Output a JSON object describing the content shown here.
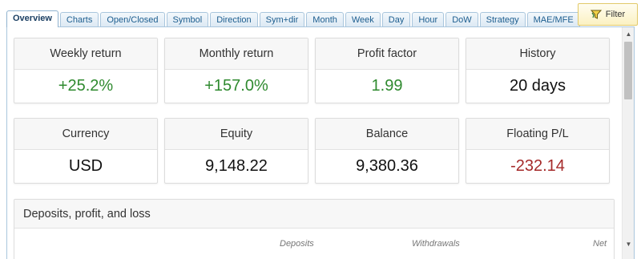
{
  "tabs": [
    {
      "label": "Overview",
      "active": true
    },
    {
      "label": "Charts"
    },
    {
      "label": "Open/Closed"
    },
    {
      "label": "Symbol"
    },
    {
      "label": "Direction"
    },
    {
      "label": "Sym+dir"
    },
    {
      "label": "Month"
    },
    {
      "label": "Week"
    },
    {
      "label": "Day"
    },
    {
      "label": "Hour"
    },
    {
      "label": "DoW"
    },
    {
      "label": "Strategy"
    },
    {
      "label": "MAE/MFE"
    }
  ],
  "filter": {
    "label": "Filter",
    "icon": "filter-funnel-icon"
  },
  "cards": [
    {
      "title": "Weekly return",
      "value": "+25.2%",
      "tone": "positive"
    },
    {
      "title": "Monthly return",
      "value": "+157.0%",
      "tone": "positive"
    },
    {
      "title": "Profit factor",
      "value": "1.99",
      "tone": "positive"
    },
    {
      "title": "History",
      "value": "20 days",
      "tone": "neutral"
    },
    {
      "title": "Currency",
      "value": "USD",
      "tone": "neutral"
    },
    {
      "title": "Equity",
      "value": "9,148.22",
      "tone": "neutral"
    },
    {
      "title": "Balance",
      "value": "9,380.36",
      "tone": "neutral"
    },
    {
      "title": "Floating P/L",
      "value": "-232.14",
      "tone": "negative"
    }
  ],
  "deposits_section": {
    "title": "Deposits, profit, and loss",
    "columns": [
      "Deposits",
      "Withdrawals",
      "Net"
    ]
  },
  "colors": {
    "positive": "#2f8a2f",
    "negative": "#a52a2a",
    "tab_text": "#1d5e8f",
    "filter_bg": "#fbf1c2"
  }
}
